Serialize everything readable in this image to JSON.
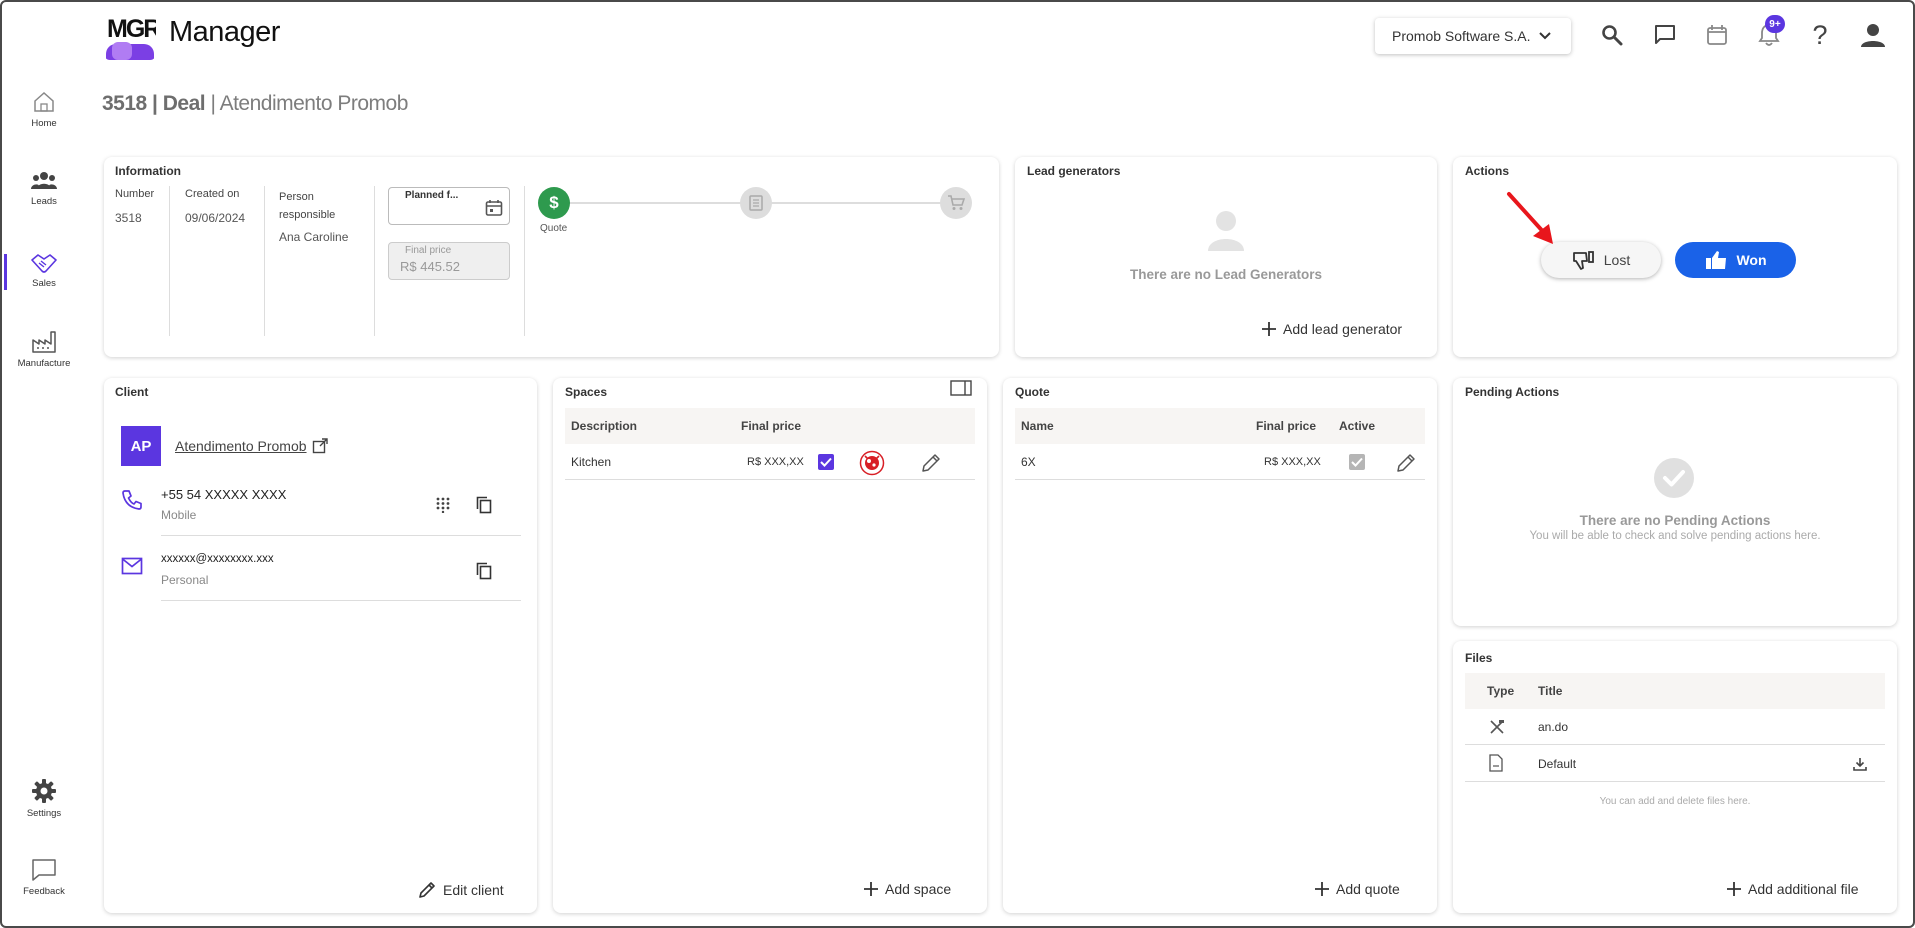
{
  "header": {
    "logo_text": "MGR",
    "app_title": "Manager",
    "company_select": "Promob Software S.A.",
    "notifications_badge": "9+"
  },
  "sidebar": {
    "items": [
      {
        "label": "Home",
        "icon": "home-icon"
      },
      {
        "label": "Leads",
        "icon": "people-icon"
      },
      {
        "label": "Sales",
        "icon": "handshake-icon"
      },
      {
        "label": "Manufacture",
        "icon": "factory-icon"
      },
      {
        "label": "Settings",
        "icon": "gear-icon"
      },
      {
        "label": "Feedback",
        "icon": "chat-icon"
      }
    ]
  },
  "breadcrumb": {
    "id_deal": "3518 | Deal",
    "separator": " | ",
    "name": "Atendimento Promob"
  },
  "information": {
    "title": "Information",
    "number_label": "Number",
    "number_value": "3518",
    "created_label": "Created on",
    "created_value": "09/06/2024",
    "person_label": "Person responsible",
    "person_value": "Ana Caroline",
    "planned_label": "Planned f...",
    "final_price_label": "Final price",
    "final_price_value": "R$ 445.52",
    "steps": [
      {
        "label": "Quote",
        "icon": "dollar-icon",
        "active": true
      },
      {
        "label": "",
        "icon": "document-icon",
        "active": false
      },
      {
        "label": "",
        "icon": "cart-icon",
        "active": false
      }
    ]
  },
  "lead_generators": {
    "title": "Lead generators",
    "empty_text": "There are no Lead Generators",
    "add_label": "Add lead generator"
  },
  "actions": {
    "title": "Actions",
    "lost_label": "Lost",
    "won_label": "Won"
  },
  "client": {
    "title": "Client",
    "initials": "AP",
    "name": "Atendimento Promob",
    "phone": "+55 54 XXXXX XXXX",
    "phone_type": "Mobile",
    "email": "xxxxxx@xxxxxxxx.xxx",
    "email_type": "Personal",
    "edit_label": "Edit client"
  },
  "spaces": {
    "title": "Spaces",
    "columns": [
      "Description",
      "Final price"
    ],
    "rows": [
      {
        "description": "Kitchen",
        "price": "R$ XXX,XX"
      }
    ],
    "add_label": "Add space"
  },
  "quote": {
    "title": "Quote",
    "columns": [
      "Name",
      "Final price",
      "Active"
    ],
    "rows": [
      {
        "name": "6X",
        "price": "R$ XXX,XX"
      }
    ],
    "add_label": "Add quote"
  },
  "pending": {
    "title": "Pending Actions",
    "empty_title": "There are no Pending Actions",
    "empty_sub": "You will be able to check and solve pending actions here."
  },
  "files": {
    "title": "Files",
    "columns": [
      "Type",
      "Title"
    ],
    "rows": [
      {
        "title": "an.do",
        "icon": "tools-icon"
      },
      {
        "title": "Default",
        "icon": "pdf-icon"
      }
    ],
    "hint": "You can add and delete files here.",
    "add_label": "Add additional file"
  },
  "colors": {
    "accent": "#5b36e0",
    "won": "#1a62e8",
    "quote_step": "#2e9a4e",
    "annotation_arrow": "#e8161c"
  }
}
